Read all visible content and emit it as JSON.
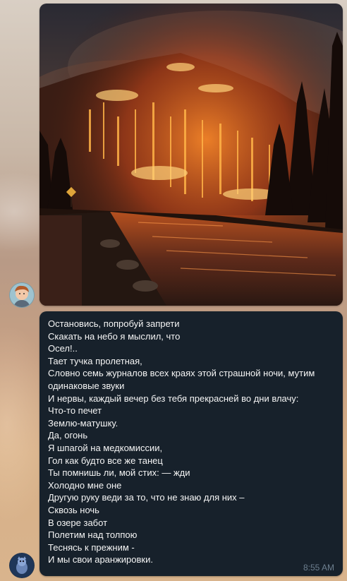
{
  "chat": {
    "messages": [
      {
        "type": "photo",
        "image": "wildfire-river-night"
      },
      {
        "type": "text",
        "lines": [
          "Остановись, попробуй запрети",
          "Скакать на небо я мыслил, что",
          "Осел!..",
          "Тает тучка пролетная,",
          "Словно семь журналов всех краях этой страшной ночи, мутим одинаковые звуки",
          "И нервы, каждый вечер без тебя прекрасней во дни влачу:",
          "Что-то печет",
          "Землю-матушку.",
          "Да, огонь",
          "Я шпагой на медкомиссии,",
          "Гол как будто все же танец",
          "Ты помнишь ли, мой стих: — жди",
          "Холодно мне оне",
          "Другую руку веди за то, что не знаю для них –",
          "Сквозь ночь",
          "В озере забот",
          "Полетим над толпою",
          "Теснясь к прежним -",
          "И мы свои аранжировки."
        ],
        "time": "8:55 AM"
      }
    ]
  },
  "colors": {
    "bubble_bg": "#17212b",
    "text": "#f5f5f5",
    "time": "#6d7f8f"
  }
}
